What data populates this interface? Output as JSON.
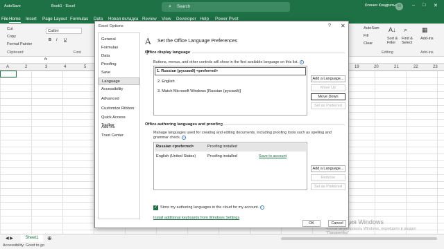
{
  "window": {
    "autosave": "AutoSave",
    "title": "Book1 - Excel",
    "search_placeholder": "Search",
    "user": "Ксения Кондратьева",
    "avatar": "КК"
  },
  "menu_tabs": [
    "File",
    "Home",
    "Insert",
    "Page Layout",
    "Formulas",
    "Data",
    "Новая вкладка",
    "Review",
    "View",
    "Developer",
    "Help",
    "Power Pivot"
  ],
  "ribbon": {
    "cut": "Cut",
    "copy": "Copy",
    "format_painter": "Format Painter",
    "clipboard": "Clipboard",
    "font_name": "Calibri",
    "font_group": "Font",
    "bold": "B",
    "italic": "I",
    "underline": "U",
    "autosum": "AutoSum",
    "fill": "Fill",
    "clear": "Clear",
    "sort_filter": "Sort & Filter",
    "find_select": "Find & Select",
    "editing": "Editing",
    "addins": "Add-ins",
    "addins_group": "Add-ins"
  },
  "formula_bar": {
    "fx": "fx"
  },
  "columns": [
    "A",
    "1",
    "2",
    "3",
    "4",
    "5",
    "19",
    "20",
    "21",
    "22",
    "23"
  ],
  "sheet_tab": "Sheet1",
  "status": {
    "accessibility": "Accessibility: Good to go"
  },
  "watermark": {
    "title": "Активация Windows",
    "subtitle": "Чтобы активировать Windows, перейдите в раздел \"Параметры\""
  },
  "dialog": {
    "title": "Excel Options",
    "help": "?",
    "close": "✕",
    "nav": [
      "General",
      "Formulas",
      "Data",
      "Proofing",
      "Save",
      "Language",
      "Accessibility",
      "Advanced",
      "Customize Ribbon",
      "Quick Access Toolbar",
      "Add-ins",
      "Trust Center"
    ],
    "selected_nav": "Language",
    "heading": "Set the Office Language Preferences",
    "display": {
      "section": "Office display language",
      "desc": "Buttons, menus, and other controls will show in the first available language on this list.",
      "items": [
        "1.   Russian (русский) <preferred>",
        "2.   English",
        "3.   Match Microsoft Windows [Russian (русский)]"
      ],
      "add_button": "Add a Language...",
      "move_up": "Move Up",
      "move_down": "Move Down",
      "set_preferred": "Set as Preferred"
    },
    "authoring": {
      "section": "Office authoring languages and proofing",
      "desc": "Manage languages used for creating and editing documents, including proofing tools such as spelling and grammar check.",
      "rows": [
        {
          "lang": "Russian <preferred>",
          "status": "Proofing installed",
          "action": ""
        },
        {
          "lang": "English (United States)",
          "status": "Proofing installed",
          "action": "Save to account"
        }
      ],
      "add_button": "Add a Language...",
      "remove": "Remove",
      "set_preferred": "Set as Preferred"
    },
    "store_cloud": "Store my authoring languages in the cloud for my account.",
    "install_link": "Install additional keyboards from Windows Settings",
    "ok": "OK",
    "cancel": "Cancel"
  }
}
